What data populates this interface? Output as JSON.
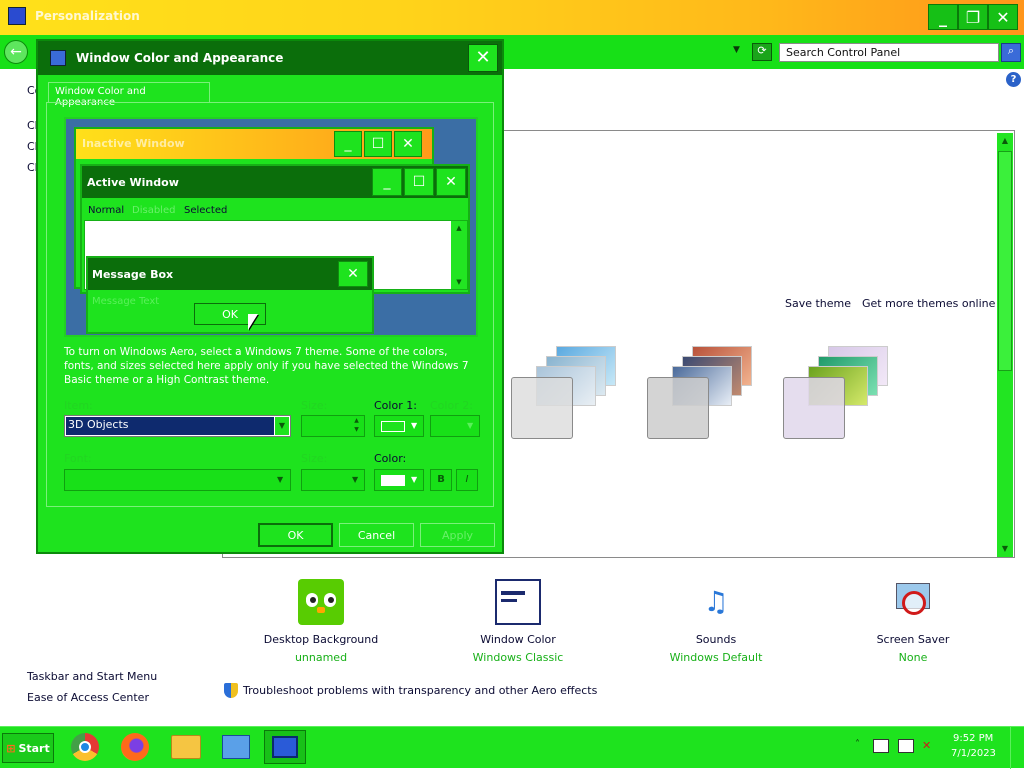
{
  "window": {
    "title": "Personalization",
    "address": {
      "search_placeholder": "Search Control Panel"
    },
    "sidebar": {
      "items": [
        "Co",
        "Ch",
        "Ch",
        "Ch"
      ],
      "see_also": [
        "Taskbar and Start Menu",
        "Ease of Access Center"
      ]
    },
    "themes": {
      "save_theme": "Save theme",
      "get_more": "Get more themes online"
    },
    "bottom": [
      {
        "label": "Desktop Background",
        "sub": "unnamed"
      },
      {
        "label": "Window Color",
        "sub": "Windows Classic"
      },
      {
        "label": "Sounds",
        "sub": "Windows Default"
      },
      {
        "label": "Screen Saver",
        "sub": "None"
      }
    ],
    "troubleshoot": "Troubleshoot problems with transparency and other Aero effects"
  },
  "dialog": {
    "title": "Window Color and Appearance",
    "tab": "Window Color and Appearance",
    "preview": {
      "inactive_title": "Inactive Window",
      "active_title": "Active Window",
      "menu": [
        "Normal",
        "Disabled",
        "Selected"
      ],
      "msgbox_title": "Message Box",
      "msgbox_text": "Message Text",
      "msgbox_ok": "OK"
    },
    "description": "To turn on Windows Aero, select a Windows 7 theme. Some of the colors, fonts, and sizes selected here apply only if you have selected the Windows 7 Basic theme or a High Contrast theme.",
    "labels": {
      "item": "Item:",
      "size": "Size:",
      "color1": "Color 1:",
      "color2": "Color 2:",
      "font": "Font:",
      "size2": "Size:",
      "color": "Color:"
    },
    "item_value": "3D Objects",
    "bold": "B",
    "italic": "I",
    "buttons": {
      "ok": "OK",
      "cancel": "Cancel",
      "apply": "Apply"
    }
  },
  "taskbar": {
    "start": "Start",
    "time": "9:52 PM",
    "date": "7/1/2023"
  },
  "colors": {
    "theme_green": "#1ee31e",
    "dark_green": "#0b6e0b",
    "title_orange": "#f5a51c"
  }
}
